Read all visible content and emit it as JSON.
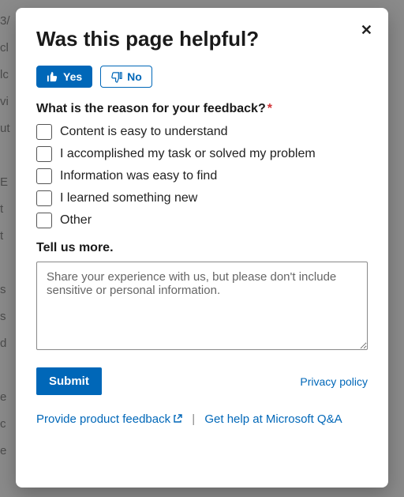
{
  "modal": {
    "title": "Was this page helpful?",
    "close_label": "✕",
    "yes_label": "Yes",
    "no_label": "No",
    "reason_question": "What is the reason for your feedback?",
    "required_mark": "*",
    "options": [
      "Content is easy to understand",
      "I accomplished my task or solved my problem",
      "Information was easy to find",
      "I learned something new",
      "Other"
    ],
    "tell_more_label": "Tell us more.",
    "textarea_placeholder": "Share your experience with us, but please don't include sensitive or personal information.",
    "submit_label": "Submit",
    "privacy_label": "Privacy policy",
    "product_feedback_label": "Provide product feedback",
    "qa_help_label": "Get help at Microsoft Q&A",
    "separator": "|"
  }
}
